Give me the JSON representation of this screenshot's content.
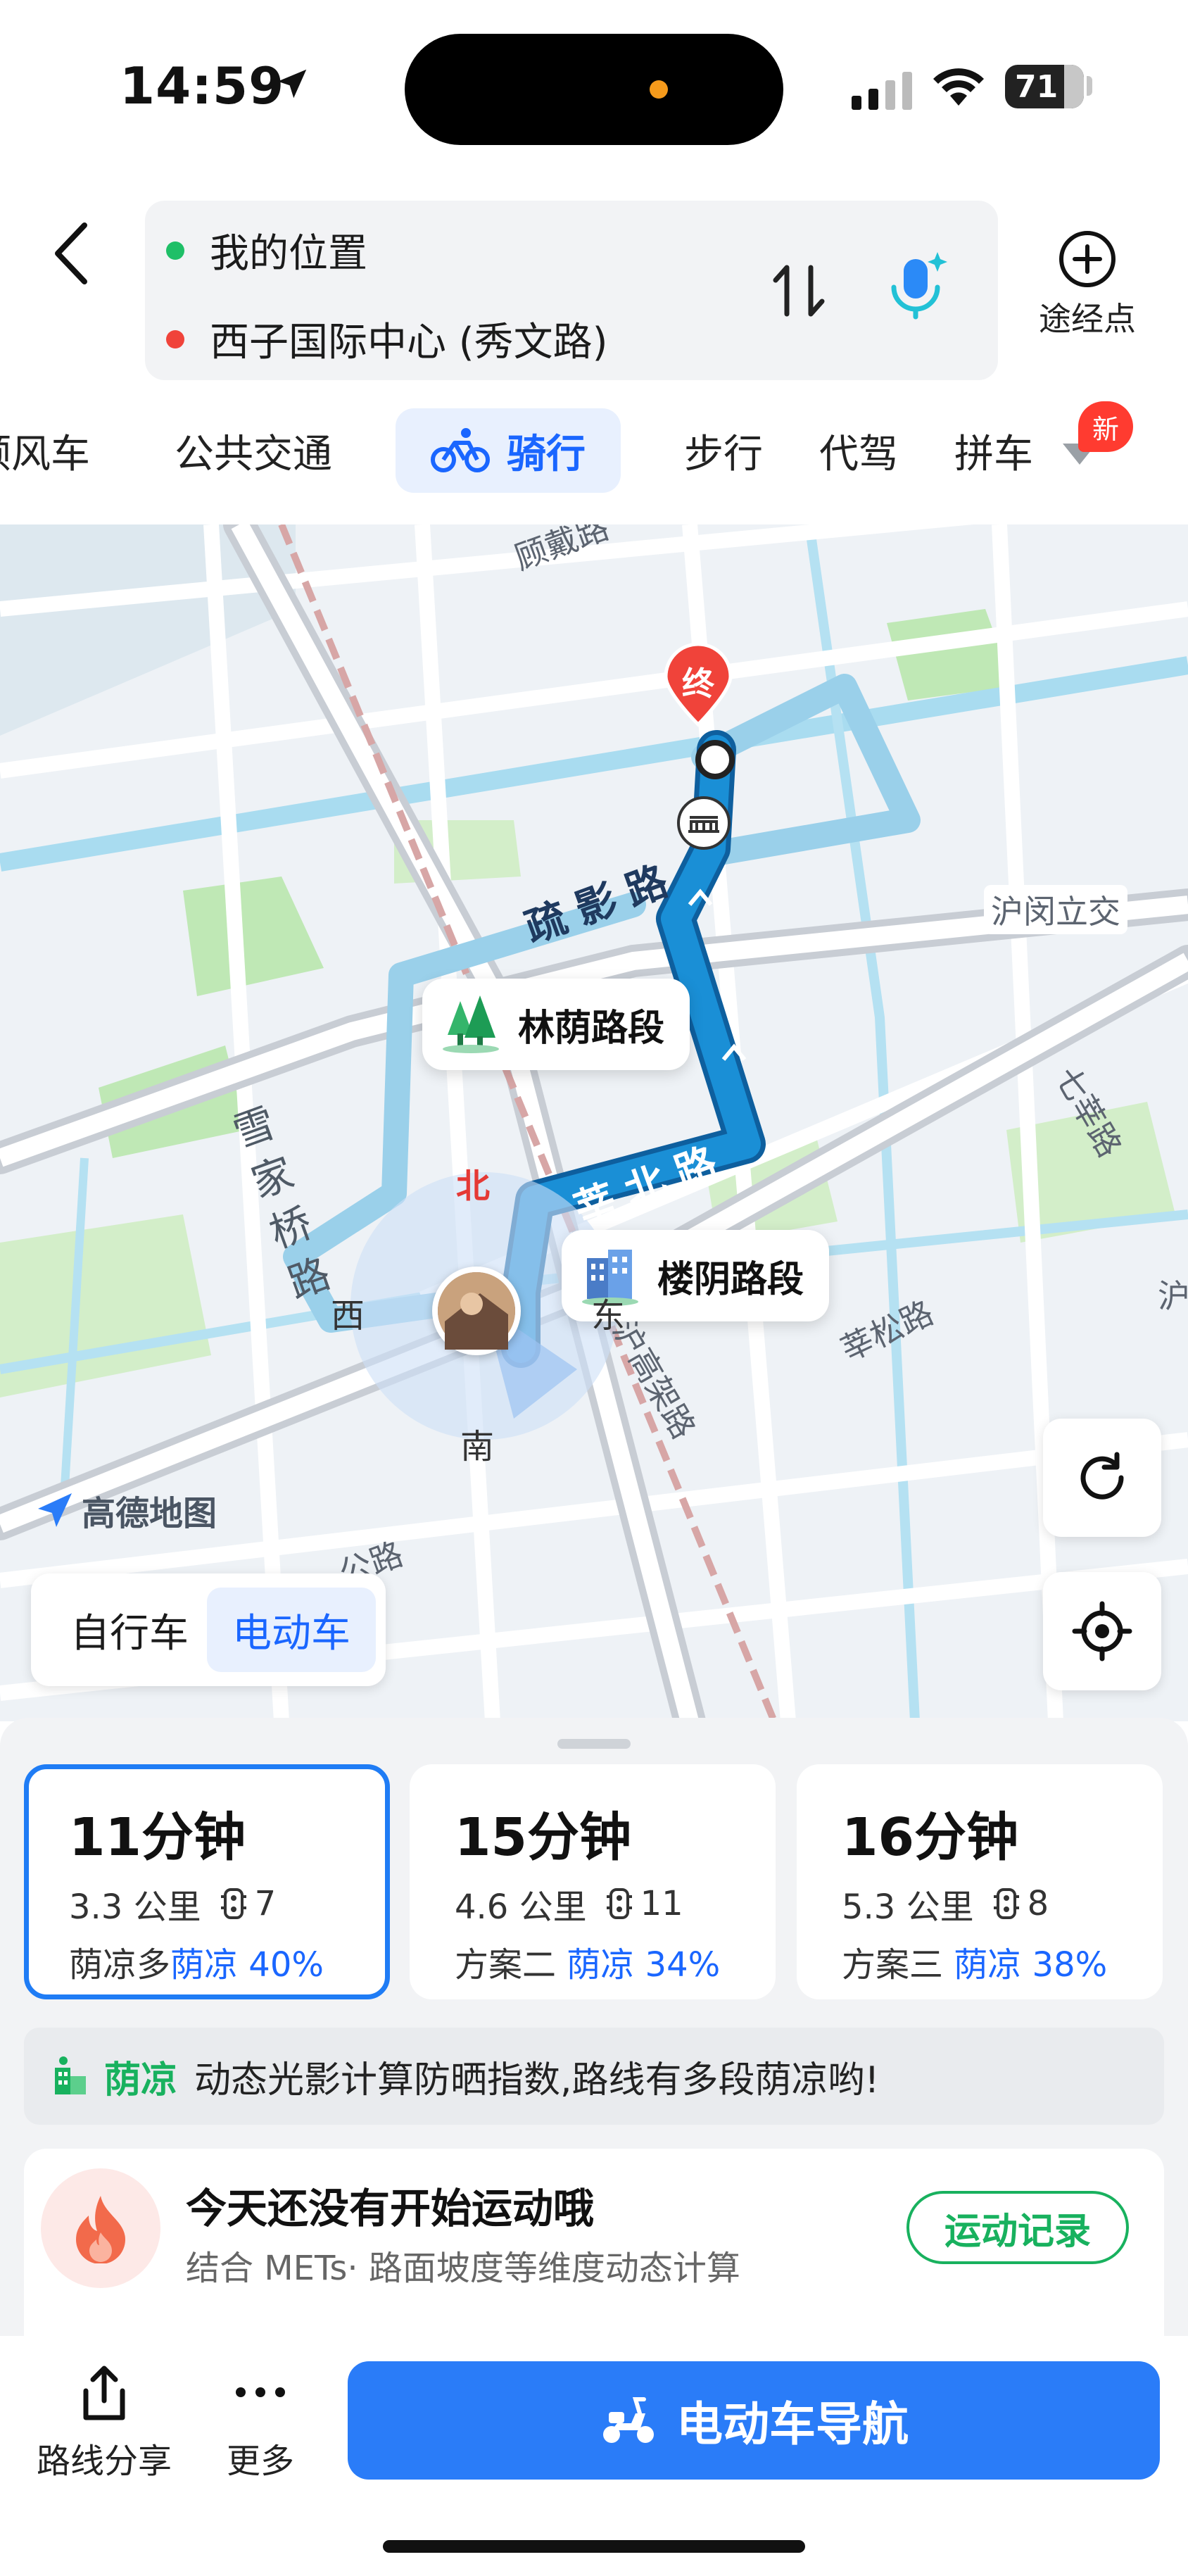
{
  "status_bar": {
    "time": "14:59",
    "battery": "71"
  },
  "header": {
    "origin": "我的位置",
    "destination": "西子国际中心 (秀文路)",
    "waypoint_label": "途经点"
  },
  "tabs": [
    {
      "label": "顺风车"
    },
    {
      "label": "公共交通"
    },
    {
      "label": "骑行"
    },
    {
      "label": "步行"
    },
    {
      "label": "代驾"
    },
    {
      "label": "拼车"
    }
  ],
  "new_badge": "新",
  "map": {
    "labels": {
      "gudai": "顾戴路",
      "huminli": "沪闵立交",
      "qixin": "七莘路",
      "xinsong": "莘松路",
      "hu": "沪",
      "gaojia": "沪高架路",
      "gong": "公路"
    },
    "roads": {
      "shuying": "疏影路",
      "xinbei": "莘北路",
      "xuejia": "雪家桥路"
    },
    "destination_marker": "终",
    "bubbles": {
      "forest": "林荫路段",
      "building": "楼阴路段"
    },
    "compass": {
      "north": "北",
      "south": "南",
      "west": "西",
      "east": "东"
    },
    "logo": "高德地图",
    "vehicle_toggle": {
      "bicycle": "自行车",
      "ebike": "电动车"
    }
  },
  "routes": [
    {
      "duration": "11分钟",
      "distance": "3.3 公里",
      "lights": "7",
      "tag": "荫凉多",
      "shade": "荫凉 40%"
    },
    {
      "duration": "15分钟",
      "distance": "4.6 公里",
      "lights": "11",
      "tag": "方案二",
      "shade": "荫凉 34%"
    },
    {
      "duration": "16分钟",
      "distance": "5.3 公里",
      "lights": "8",
      "tag": "方案三",
      "shade": "荫凉 38%"
    }
  ],
  "shade_banner": {
    "tag": "荫凉",
    "text": "动态光影计算防晒指数,路线有多段荫凉哟!"
  },
  "sport": {
    "title": "今天还没有开始运动哦",
    "subtitle": "结合 METs· 路面坡度等维度动态计算",
    "button": "运动记录"
  },
  "bottom_bar": {
    "share": "路线分享",
    "more": "更多",
    "navigate": "电动车导航"
  },
  "colors": {
    "accent": "#1a66ff",
    "shade_green": "#18b15e",
    "route": "#1a8fd6",
    "alt_route": "#9ad0ea"
  }
}
